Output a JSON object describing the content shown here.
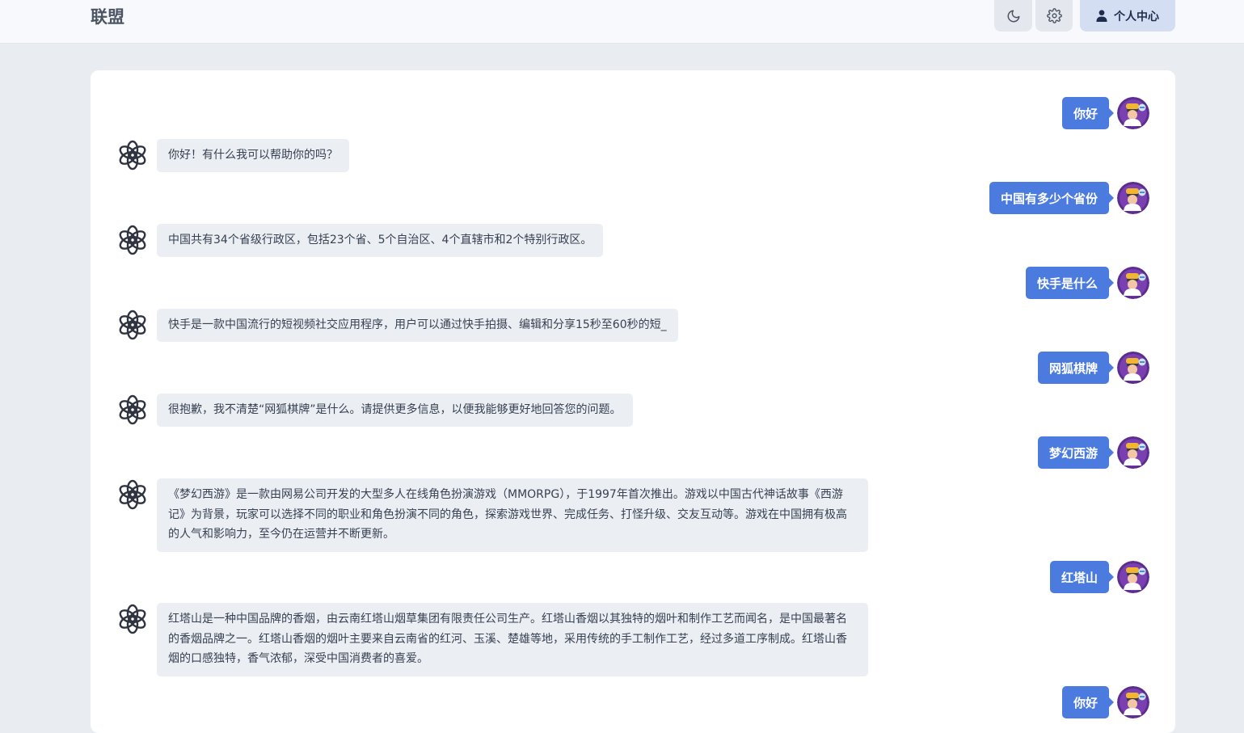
{
  "header": {
    "brand": "联盟",
    "theme_icon": "moon-icon",
    "settings_icon": "gear-icon",
    "user_center_label": "个人中心",
    "user_icon": "user-icon"
  },
  "messages": [
    {
      "role": "user",
      "text": "你好"
    },
    {
      "role": "assistant",
      "text": "你好！有什么我可以帮助你的吗？"
    },
    {
      "role": "user",
      "text": "中国有多少个省份"
    },
    {
      "role": "assistant",
      "text": "中国共有34个省级行政区，包括23个省、5个自治区、4个直辖市和2个特别行政区。"
    },
    {
      "role": "user",
      "text": "快手是什么"
    },
    {
      "role": "assistant",
      "text": "快手是一款中国流行的短视频社交应用程序，用户可以通过快手拍摄、编辑和分享15秒至60秒的短_"
    },
    {
      "role": "user",
      "text": "网狐棋牌"
    },
    {
      "role": "assistant",
      "text": "很抱歉，我不清楚“网狐棋牌”是什么。请提供更多信息，以便我能够更好地回答您的问题。"
    },
    {
      "role": "user",
      "text": "梦幻西游"
    },
    {
      "role": "assistant",
      "text": "《梦幻西游》是一款由网易公司开发的大型多人在线角色扮演游戏（MMORPG），于1997年首次推出。游戏以中国古代神话故事《西游记》为背景，玩家可以选择不同的职业和角色扮演不同的角色，探索游戏世界、完成任务、打怪升级、交友互动等。游戏在中国拥有极高的人气和影响力，至今仍在运营并不断更新。"
    },
    {
      "role": "user",
      "text": "红塔山"
    },
    {
      "role": "assistant",
      "text": "红塔山是一种中国品牌的香烟，由云南红塔山烟草集团有限责任公司生产。红塔山香烟以其独特的烟叶和制作工艺而闻名，是中国最著名的香烟品牌之一。红塔山香烟的烟叶主要来自云南省的红河、玉溪、楚雄等地，采用传统的手工制作工艺，经过多道工序制成。红塔山香烟的口感独特，香气浓郁，深受中国消费者的喜爱。"
    },
    {
      "role": "user",
      "text": "你好"
    }
  ]
}
